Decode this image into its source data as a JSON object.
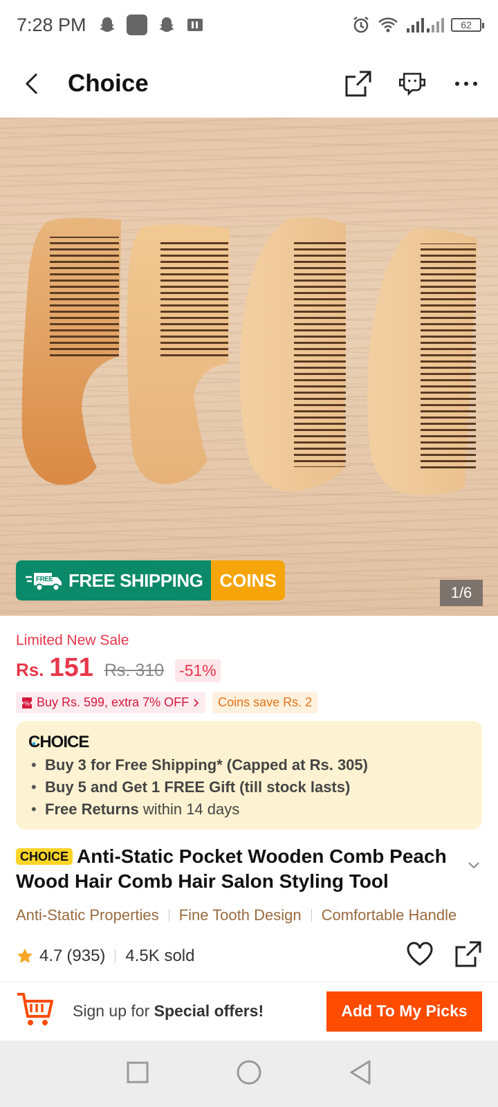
{
  "status_bar": {
    "time": "7:28 PM",
    "battery": "62"
  },
  "header": {
    "title": "Choice"
  },
  "hero": {
    "free_shipping": "FREE SHIPPING",
    "free_tag": "FREE",
    "coins": "COINS",
    "pager": "1/6"
  },
  "pricing": {
    "sale_label": "Limited New Sale",
    "currency": "Rs.",
    "price": "151",
    "original_price": "Rs. 310",
    "discount": "-51%",
    "promo_1": "Buy Rs. 599, extra 7% OFF",
    "promo_2": "Coins save Rs. 2"
  },
  "choice_card": {
    "logo": "CHOICE",
    "bullet_1": "Buy 3 for  Free Shipping* (Capped at Rs. 305)",
    "bullet_2": "Buy 5 and Get 1 FREE Gift (till stock lasts)",
    "bullet_3_bold": "Free Returns",
    "bullet_3_rest": " within 14 days"
  },
  "product": {
    "tag": "CHOICE",
    "title": "Anti-Static Pocket Wooden Comb Peach Wood Hair Comb Hair Salon Styling Tool",
    "features": [
      "Anti-Static Properties",
      "Fine Tooth Design",
      "Comfortable Handle"
    ],
    "rating": "4.7",
    "reviews": "(935)",
    "sold": "4.5K sold"
  },
  "bottom_bar": {
    "signup_prefix": "Sign up for ",
    "signup_bold": "Special offers!",
    "add_button": "Add To My Picks"
  },
  "colors": {
    "accent": "#fd4b00",
    "price_red": "#e8374a",
    "shipping_green": "#0b8a6a",
    "coins_orange": "#f5a50a",
    "choice_yellow": "#fdd428"
  }
}
